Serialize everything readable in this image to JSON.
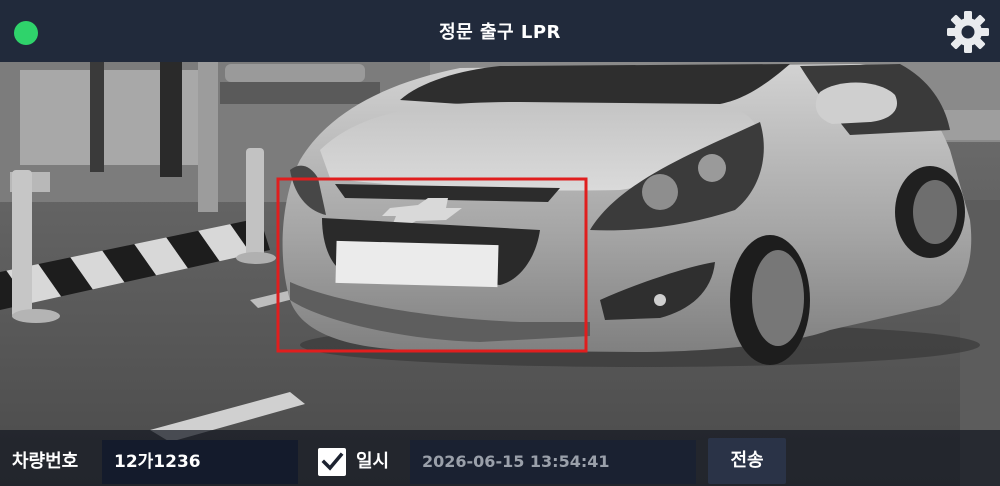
{
  "header": {
    "title": "정문 출구 LPR",
    "status": "online",
    "status_color": "#2fd36b",
    "settings_icon": "gear-icon"
  },
  "camera": {
    "feed": "front-view-vehicle",
    "detection_box_color": "#e01e1e"
  },
  "footer": {
    "plate_label": "차량번호",
    "plate_value": "12가1236",
    "datetime_checked": true,
    "datetime_label": "일시",
    "datetime_value": "2026-06-15 13:54:41",
    "send_label": "전송"
  }
}
